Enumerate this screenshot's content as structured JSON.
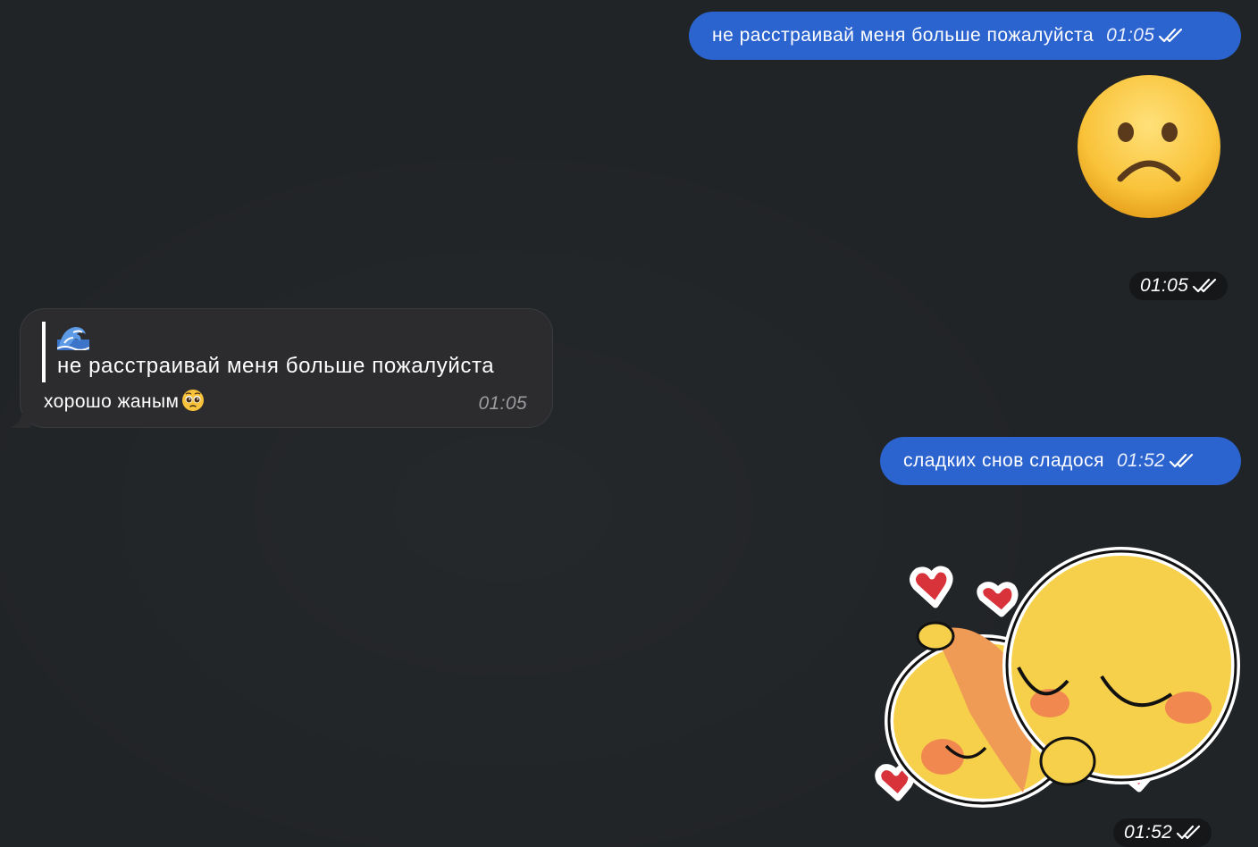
{
  "messages": [
    {
      "direction": "outgoing",
      "text": "не расстраивай меня больше пожалуйста",
      "time": "01:05",
      "status": "read"
    },
    {
      "direction": "outgoing",
      "type": "emoji",
      "emoji": "frowning-face",
      "time": "01:05",
      "status": "read"
    },
    {
      "direction": "incoming",
      "reply": {
        "icon": "water-wave-emoji",
        "quote": "не расстраивай меня больше пожалуйста"
      },
      "text": "хорошо жаным",
      "emoji": "pleading-face",
      "time": "01:05"
    },
    {
      "direction": "outgoing",
      "text": "сладких снов сладося",
      "time": "01:52",
      "status": "read"
    },
    {
      "direction": "outgoing",
      "type": "sticker",
      "sticker": "cuddling-chicks-with-hearts",
      "time": "01:52",
      "status": "read"
    }
  ],
  "colors": {
    "background": "#212427",
    "outgoing_bubble": "#2b63cf",
    "incoming_bubble": "#2c2c2e",
    "time_pill": "#151719"
  }
}
